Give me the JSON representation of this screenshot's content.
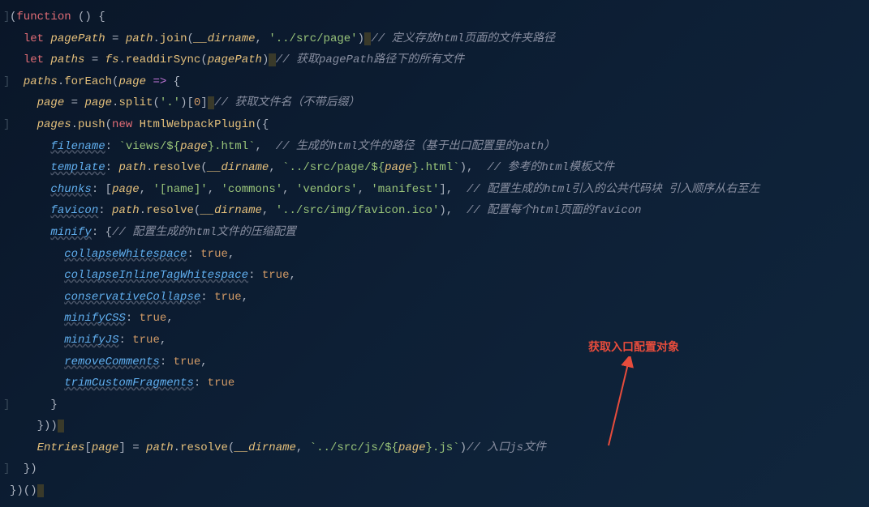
{
  "code": {
    "l1": {
      "gutter": "]",
      "a": "(",
      "b": "function",
      "c": " () {",
      "comment": ""
    },
    "l2": {
      "gutter": "",
      "indent": "  ",
      "a": "let",
      "b": " pagePath",
      "c": " = ",
      "d": "path",
      "e": ".",
      "f": "join",
      "g": "(",
      "h": "__dirname",
      "i": ", ",
      "j": "'../src/page'",
      "k": ")",
      "hl": " ",
      "cmt": "// 定义存放html页面的文件夹路径"
    },
    "l3": {
      "gutter": "",
      "indent": "  ",
      "a": "let",
      "b": " paths",
      "c": " = ",
      "d": "fs",
      "e": ".",
      "f": "readdirSync",
      "g": "(",
      "h": "pagePath",
      "i": ")",
      "hl": " ",
      "cmt": "// 获取pagePath路径下的所有文件"
    },
    "l4": {
      "gutter": "]",
      "indent": "  ",
      "a": "paths",
      "b": ".",
      "c": "forEach",
      "d": "(",
      "e": "page",
      "f": " => ",
      "g": "{"
    },
    "l5": {
      "gutter": "",
      "indent": "    ",
      "a": "page",
      "b": " = ",
      "c": "page",
      "d": ".",
      "e": "split",
      "f": "(",
      "g": "'.'",
      "h": ")[",
      "i": "0",
      "j": "]",
      "hl": " ",
      "cmt": "// 获取文件名（不带后缀）"
    },
    "l6": {
      "gutter": "]",
      "indent": "    ",
      "a": "pages",
      "b": ".",
      "c": "push",
      "d": "(",
      "e": "new",
      "f": " HtmlWebpackPlugin",
      "g": "({"
    },
    "l7": {
      "gutter": "",
      "indent": "      ",
      "a": "filename",
      "b": ": ",
      "c": "`views/${",
      "d": "page",
      "e": "}.html`",
      "f": ",  ",
      "cmt": "// 生成的html文件的路径（基于出口配置里的path）"
    },
    "l8": {
      "gutter": "",
      "indent": "      ",
      "a": "template",
      "b": ": ",
      "c": "path",
      "d": ".",
      "e": "resolve",
      "f": "(",
      "g": "__dirname",
      "h": ", ",
      "i": "`../src/page/${",
      "j": "page",
      "k": "}.html`",
      "l": "),  ",
      "cmt": "// 参考的html模板文件"
    },
    "l9": {
      "gutter": "",
      "indent": "      ",
      "a": "chunks",
      "b": ": [",
      "c": "page",
      "d": ", ",
      "e": "'[name]'",
      "f": ", ",
      "g": "'commons'",
      "h": ", ",
      "i": "'vendors'",
      "j": ", ",
      "k": "'manifest'",
      "l": "],  ",
      "cmt": "// 配置生成的html引入的公共代码块 引入顺序从右至左"
    },
    "l10": {
      "gutter": "",
      "indent": "      ",
      "a": "favicon",
      "b": ": ",
      "c": "path",
      "d": ".",
      "e": "resolve",
      "f": "(",
      "g": "__dirname",
      "h": ", ",
      "i": "'../src/img/favicon.ico'",
      "j": "),  ",
      "cmt": "// 配置每个html页面的favicon"
    },
    "l11": {
      "gutter": "",
      "indent": "      ",
      "a": "minify",
      "b": ": {",
      "cmt": "// 配置生成的html文件的压缩配置"
    },
    "l12": {
      "gutter": "",
      "indent": "        ",
      "a": "collapseWhitespace",
      "b": ": ",
      "c": "true",
      "d": ","
    },
    "l13": {
      "gutter": "",
      "indent": "        ",
      "a": "collapseInlineTagWhitespace",
      "b": ": ",
      "c": "true",
      "d": ","
    },
    "l14": {
      "gutter": "",
      "indent": "        ",
      "a": "conservativeCollapse",
      "b": ": ",
      "c": "true",
      "d": ","
    },
    "l15": {
      "gutter": "",
      "indent": "        ",
      "a": "minifyCSS",
      "b": ": ",
      "c": "true",
      "d": ","
    },
    "l16": {
      "gutter": "",
      "indent": "        ",
      "a": "minifyJS",
      "b": ": ",
      "c": "true",
      "d": ","
    },
    "l17": {
      "gutter": "",
      "indent": "        ",
      "a": "removeComments",
      "b": ": ",
      "c": "true",
      "d": ","
    },
    "l18": {
      "gutter": "",
      "indent": "        ",
      "a": "trimCustomFragments",
      "b": ": ",
      "c": "true"
    },
    "l19": {
      "gutter": "]",
      "indent": "      ",
      "a": "}"
    },
    "l20": {
      "gutter": "",
      "indent": "    ",
      "a": "}))",
      "hl": " "
    },
    "l21": {
      "gutter": "",
      "indent": "    ",
      "a": "Entries",
      "b": "[",
      "c": "page",
      "d": "] = ",
      "e": "path",
      "f": ".",
      "g": "resolve",
      "h": "(",
      "i": "__dirname",
      "j": ", ",
      "k": "`../src/js/${",
      "l": "page",
      "m": "}.js`",
      "n": ")",
      "cmt": "// 入口js文件"
    },
    "l22": {
      "gutter": "]",
      "indent": "  ",
      "a": "})"
    },
    "l23": {
      "gutter": "",
      "a": "})()",
      "hl": " "
    }
  },
  "annotation": {
    "text": "获取入口配置对象"
  }
}
